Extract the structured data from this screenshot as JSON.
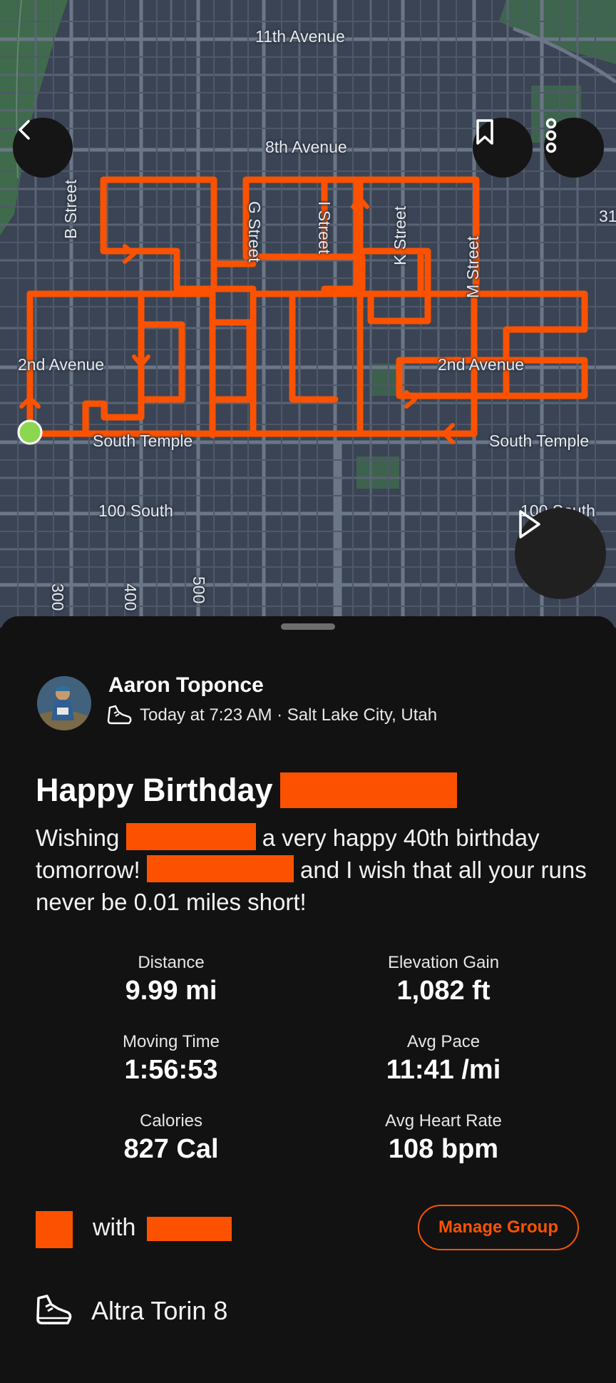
{
  "map": {
    "street_labels": {
      "eleventh_avenue": "11th Avenue",
      "eighth_avenue": "8th Avenue",
      "b_street": "B Street",
      "g_street": "G Street",
      "i_street": "I Street",
      "k_street": "K Street",
      "m_street": "M Street",
      "second_avenue_left": "2nd Avenue",
      "second_avenue_right": "2nd Avenue",
      "south_temple_left": "South Temple",
      "south_temple_right": "South Temple",
      "hundred_south_left": "100 South",
      "hundred_south_right": "100 South",
      "three_hundred": "300",
      "four_hundred": "400",
      "five_hundred": "500",
      "edge_number": "31"
    },
    "route_color": "#fc5200",
    "start_marker_color": "#8dd650"
  },
  "activity": {
    "athlete_name": "Aaron Toponce",
    "meta": "Today at 7:23 AM · Salt Lake City, Utah",
    "title": "Happy Birthday",
    "description": {
      "part1": "Wishing",
      "part2": "a very happy 40th birthday tomorrow!",
      "part3": "and I wish that all your runs never be 0.01 miles short!"
    }
  },
  "stats": [
    {
      "label": "Distance",
      "value": "9.99 mi"
    },
    {
      "label": "Elevation Gain",
      "value": "1,082 ft"
    },
    {
      "label": "Moving Time",
      "value": "1:56:53"
    },
    {
      "label": "Avg Pace",
      "value": "11:41 /mi"
    },
    {
      "label": "Calories",
      "value": "827 Cal"
    },
    {
      "label": "Avg Heart Rate",
      "value": "108 bpm"
    }
  ],
  "group": {
    "with_label": "with",
    "manage_label": "Manage Group"
  },
  "gear": {
    "label": "Altra Torin 8"
  },
  "colors": {
    "accent": "#fc5200",
    "background": "#121212"
  }
}
